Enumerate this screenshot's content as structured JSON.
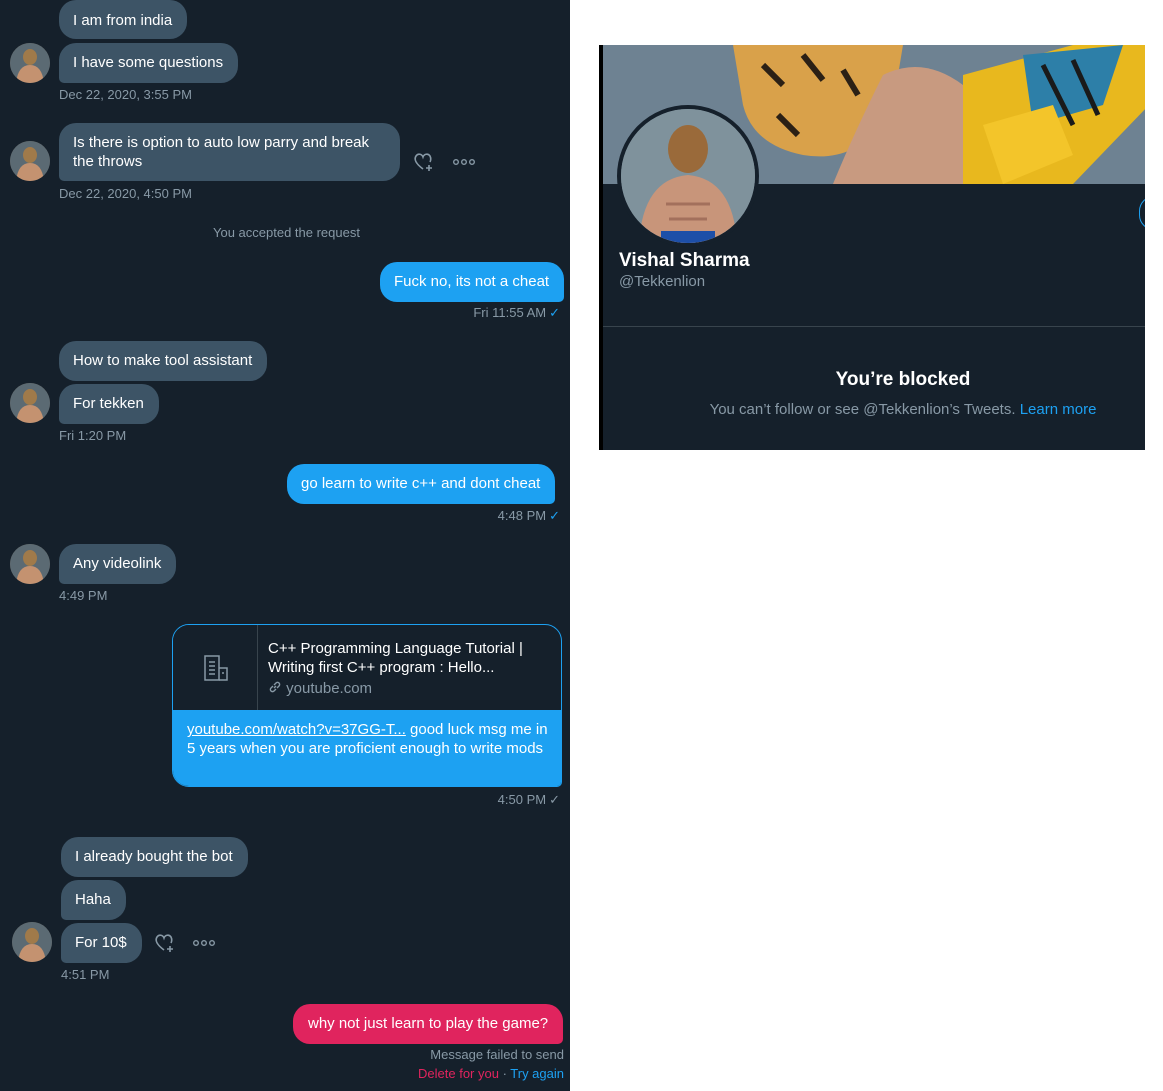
{
  "conversation": {
    "messages": [
      {
        "text": "I am from india"
      },
      {
        "text": "I have some questions"
      },
      {
        "text": "Is there is option to auto low parry and break the throws"
      },
      {
        "text": "Fuck no, its not a cheat"
      },
      {
        "text": "How to make tool assistant"
      },
      {
        "text": "For tekken"
      },
      {
        "text": "go learn to write c++ and dont cheat"
      },
      {
        "text": "Any videolink"
      },
      {
        "text": "I already bought the bot"
      },
      {
        "text": "Haha"
      },
      {
        "text": "For 10$"
      },
      {
        "text": "why not just learn to play the game?"
      }
    ],
    "timestamps": [
      "Dec 22, 2020, 3:55 PM",
      "Dec 22, 2020, 4:50 PM",
      "Fri 11:55 AM",
      "Fri 1:20 PM",
      "4:48 PM",
      "4:49 PM",
      "4:50 PM",
      "4:51 PM"
    ],
    "system_note": "You accepted the request",
    "link_card": {
      "title": "C++ Programming Language Tutorial | Writing first C++ program : Hello...",
      "domain": "youtube.com",
      "url_text": "youtube.com/watch?v=37GG-T...",
      "message_rest": " good luck msg me in 5 years when you are proficient enough to write mods"
    },
    "failed": {
      "status": "Message failed to send",
      "delete": "Delete for you",
      "separator": " · ",
      "retry": "Try again"
    },
    "icons": [
      "heart-plus-icon",
      "more-icon",
      "checkmark-icon",
      "link-icon",
      "document-icon"
    ],
    "colors": {
      "background": "#15202b",
      "incoming": "#3d5466",
      "outgoing": "#1da1f2",
      "failed": "#e0245e"
    }
  },
  "profile": {
    "name": "Vishal Sharma",
    "handle": "@Tekkenlion",
    "blocked_title": "You’re blocked",
    "blocked_desc": "You can’t follow or see @Tekkenlion’s Tweets.",
    "learn_more": "Learn more"
  }
}
